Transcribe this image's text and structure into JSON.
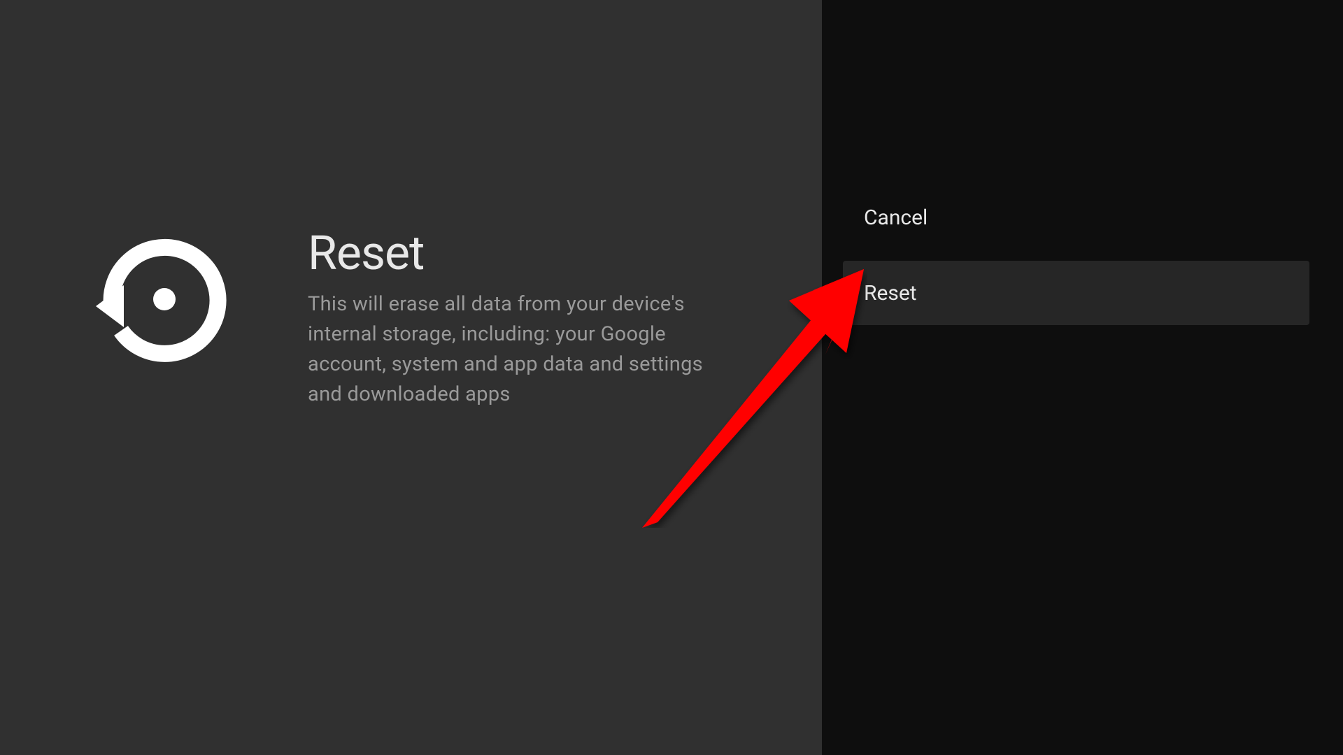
{
  "main": {
    "title": "Reset",
    "description": "This will erase all data from your device's internal storage, including: your Google account, system and app data and settings and downloaded apps"
  },
  "options": {
    "cancel": "Cancel",
    "reset": "Reset"
  }
}
